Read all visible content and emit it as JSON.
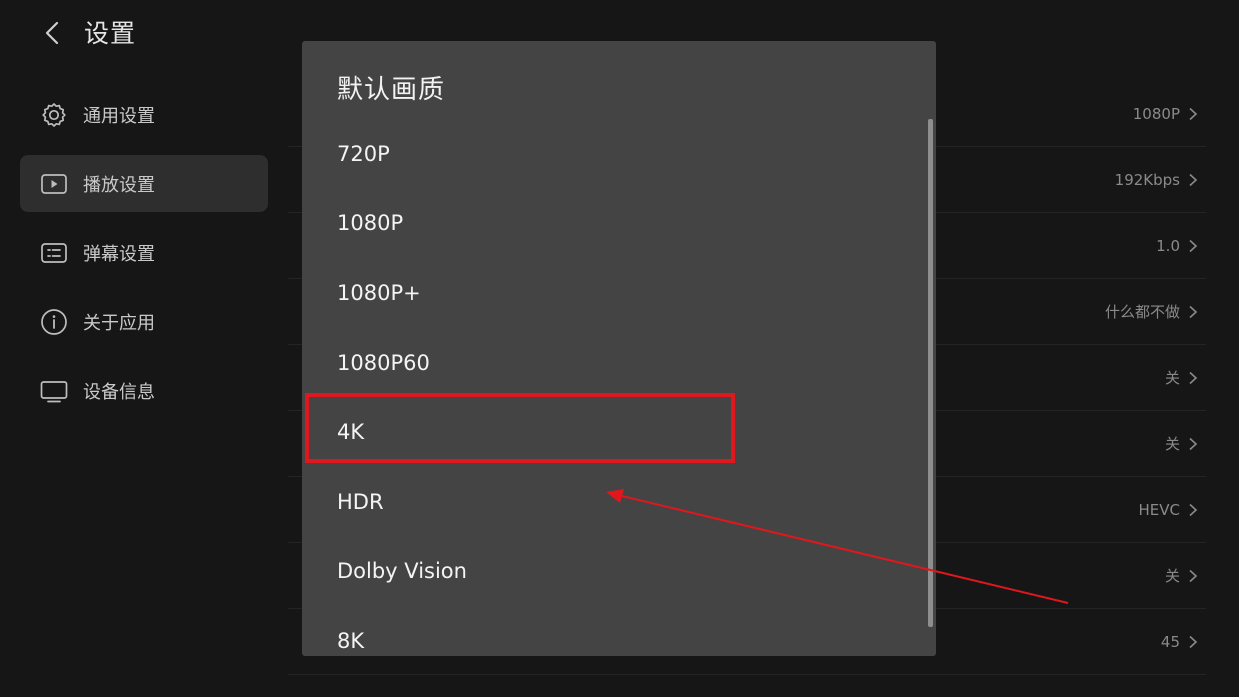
{
  "header": {
    "title": "设置"
  },
  "sidebar": {
    "items": [
      {
        "label": "通用设置",
        "icon": "gear-icon"
      },
      {
        "label": "播放设置",
        "icon": "play-icon",
        "active": true
      },
      {
        "label": "弹幕设置",
        "icon": "danmaku-icon"
      },
      {
        "label": "关于应用",
        "icon": "info-icon"
      },
      {
        "label": "设备信息",
        "icon": "monitor-icon"
      }
    ]
  },
  "settings": {
    "values": [
      "1080P",
      "192Kbps",
      "1.0",
      "什么都不做",
      "关",
      "关",
      "HEVC",
      "关",
      "45"
    ]
  },
  "dialog": {
    "title": "默认画质",
    "options": [
      "720P",
      "1080P",
      "1080P+",
      "1080P60",
      "4K",
      "HDR",
      "Dolby Vision",
      "8K"
    ],
    "highlighted_option": "4K"
  },
  "colors": {
    "background": "#161616",
    "sidebar_active": "#2e2e2e",
    "dialog_bg": "#444444",
    "annotation_red": "#e0171c"
  }
}
